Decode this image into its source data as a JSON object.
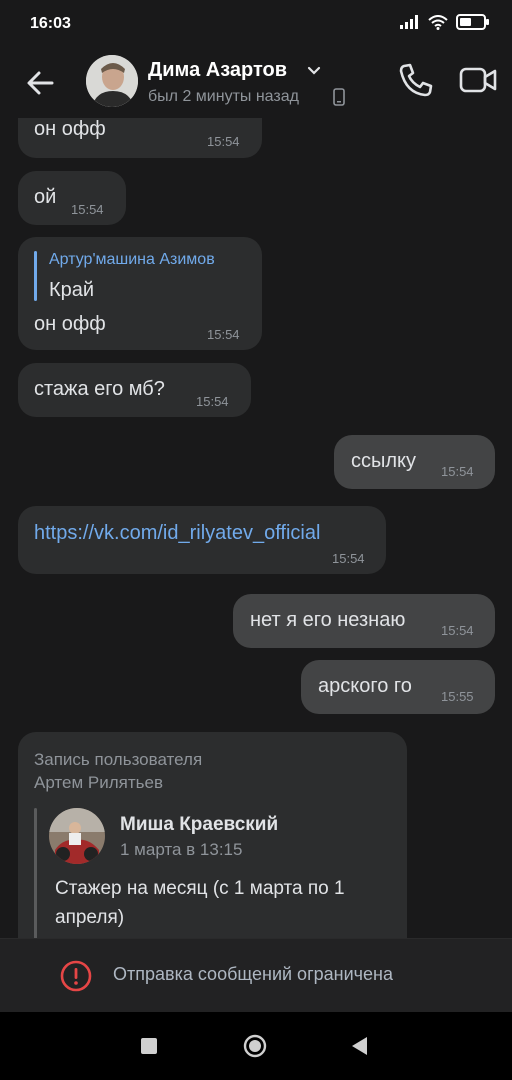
{
  "status_bar": {
    "time": "16:03",
    "icons": [
      "signal-icon",
      "wifi-icon",
      "battery-icon"
    ]
  },
  "header": {
    "contact_name": "Дима Азартов",
    "contact_status": "был 2 минуты назад",
    "icons": [
      "back-arrow-icon",
      "chevron-down-icon",
      "phone-device-icon",
      "phone-call-icon",
      "video-call-icon"
    ]
  },
  "messages": [
    {
      "direction": "in",
      "text": "он офф",
      "time": "15:54"
    },
    {
      "direction": "in",
      "text": "ой",
      "time": "15:54"
    },
    {
      "direction": "in",
      "reply_to": {
        "author": "Артур'машина Азимов",
        "text": "Край"
      },
      "text": "он офф",
      "time": "15:54"
    },
    {
      "direction": "in",
      "text": "стажа его мб?",
      "time": "15:54"
    },
    {
      "direction": "out",
      "text": "ссылку",
      "time": "15:54"
    },
    {
      "direction": "in",
      "text": "https://vk.com/id_rilyatev_official",
      "time": "15:54",
      "is_link": true
    },
    {
      "direction": "out",
      "text": "нет я его незнаю",
      "time": "15:54"
    },
    {
      "direction": "out",
      "text": "арского го",
      "time": "15:55"
    }
  ],
  "wall_post": {
    "header_line1": "Запись пользователя",
    "header_line2": "Артем Рилятьев",
    "author": "Миша Краевский",
    "date": "1 марта в 13:15",
    "text_line1": "Стажер на месяц (с 1 марта по 1",
    "text_line2": "апреля)"
  },
  "composer": {
    "restriction_text": "Отправка сообщений ограничена",
    "icon": "warning-circle-icon"
  },
  "nav_bar": {
    "icons": [
      "recents-square-icon",
      "home-circle-icon",
      "back-triangle-icon"
    ]
  },
  "colors": {
    "background": "#19191a",
    "incoming_bubble": "#2c2d2e",
    "outgoing_bubble": "#434445",
    "link": "#71aaeb",
    "warning": "#e64646"
  }
}
